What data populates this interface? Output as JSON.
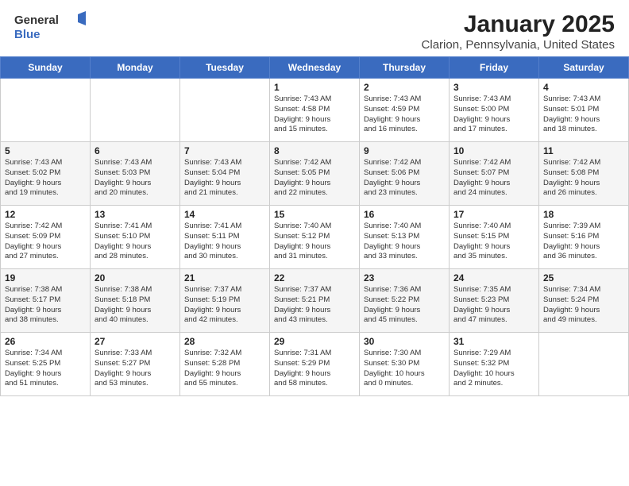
{
  "logo": {
    "text1": "General",
    "text2": "Blue"
  },
  "title": "January 2025",
  "subtitle": "Clarion, Pennsylvania, United States",
  "weekdays": [
    "Sunday",
    "Monday",
    "Tuesday",
    "Wednesday",
    "Thursday",
    "Friday",
    "Saturday"
  ],
  "weeks": [
    [
      {
        "day": "",
        "info": ""
      },
      {
        "day": "",
        "info": ""
      },
      {
        "day": "",
        "info": ""
      },
      {
        "day": "1",
        "info": "Sunrise: 7:43 AM\nSunset: 4:58 PM\nDaylight: 9 hours\nand 15 minutes."
      },
      {
        "day": "2",
        "info": "Sunrise: 7:43 AM\nSunset: 4:59 PM\nDaylight: 9 hours\nand 16 minutes."
      },
      {
        "day": "3",
        "info": "Sunrise: 7:43 AM\nSunset: 5:00 PM\nDaylight: 9 hours\nand 17 minutes."
      },
      {
        "day": "4",
        "info": "Sunrise: 7:43 AM\nSunset: 5:01 PM\nDaylight: 9 hours\nand 18 minutes."
      }
    ],
    [
      {
        "day": "5",
        "info": "Sunrise: 7:43 AM\nSunset: 5:02 PM\nDaylight: 9 hours\nand 19 minutes."
      },
      {
        "day": "6",
        "info": "Sunrise: 7:43 AM\nSunset: 5:03 PM\nDaylight: 9 hours\nand 20 minutes."
      },
      {
        "day": "7",
        "info": "Sunrise: 7:43 AM\nSunset: 5:04 PM\nDaylight: 9 hours\nand 21 minutes."
      },
      {
        "day": "8",
        "info": "Sunrise: 7:42 AM\nSunset: 5:05 PM\nDaylight: 9 hours\nand 22 minutes."
      },
      {
        "day": "9",
        "info": "Sunrise: 7:42 AM\nSunset: 5:06 PM\nDaylight: 9 hours\nand 23 minutes."
      },
      {
        "day": "10",
        "info": "Sunrise: 7:42 AM\nSunset: 5:07 PM\nDaylight: 9 hours\nand 24 minutes."
      },
      {
        "day": "11",
        "info": "Sunrise: 7:42 AM\nSunset: 5:08 PM\nDaylight: 9 hours\nand 26 minutes."
      }
    ],
    [
      {
        "day": "12",
        "info": "Sunrise: 7:42 AM\nSunset: 5:09 PM\nDaylight: 9 hours\nand 27 minutes."
      },
      {
        "day": "13",
        "info": "Sunrise: 7:41 AM\nSunset: 5:10 PM\nDaylight: 9 hours\nand 28 minutes."
      },
      {
        "day": "14",
        "info": "Sunrise: 7:41 AM\nSunset: 5:11 PM\nDaylight: 9 hours\nand 30 minutes."
      },
      {
        "day": "15",
        "info": "Sunrise: 7:40 AM\nSunset: 5:12 PM\nDaylight: 9 hours\nand 31 minutes."
      },
      {
        "day": "16",
        "info": "Sunrise: 7:40 AM\nSunset: 5:13 PM\nDaylight: 9 hours\nand 33 minutes."
      },
      {
        "day": "17",
        "info": "Sunrise: 7:40 AM\nSunset: 5:15 PM\nDaylight: 9 hours\nand 35 minutes."
      },
      {
        "day": "18",
        "info": "Sunrise: 7:39 AM\nSunset: 5:16 PM\nDaylight: 9 hours\nand 36 minutes."
      }
    ],
    [
      {
        "day": "19",
        "info": "Sunrise: 7:38 AM\nSunset: 5:17 PM\nDaylight: 9 hours\nand 38 minutes."
      },
      {
        "day": "20",
        "info": "Sunrise: 7:38 AM\nSunset: 5:18 PM\nDaylight: 9 hours\nand 40 minutes."
      },
      {
        "day": "21",
        "info": "Sunrise: 7:37 AM\nSunset: 5:19 PM\nDaylight: 9 hours\nand 42 minutes."
      },
      {
        "day": "22",
        "info": "Sunrise: 7:37 AM\nSunset: 5:21 PM\nDaylight: 9 hours\nand 43 minutes."
      },
      {
        "day": "23",
        "info": "Sunrise: 7:36 AM\nSunset: 5:22 PM\nDaylight: 9 hours\nand 45 minutes."
      },
      {
        "day": "24",
        "info": "Sunrise: 7:35 AM\nSunset: 5:23 PM\nDaylight: 9 hours\nand 47 minutes."
      },
      {
        "day": "25",
        "info": "Sunrise: 7:34 AM\nSunset: 5:24 PM\nDaylight: 9 hours\nand 49 minutes."
      }
    ],
    [
      {
        "day": "26",
        "info": "Sunrise: 7:34 AM\nSunset: 5:25 PM\nDaylight: 9 hours\nand 51 minutes."
      },
      {
        "day": "27",
        "info": "Sunrise: 7:33 AM\nSunset: 5:27 PM\nDaylight: 9 hours\nand 53 minutes."
      },
      {
        "day": "28",
        "info": "Sunrise: 7:32 AM\nSunset: 5:28 PM\nDaylight: 9 hours\nand 55 minutes."
      },
      {
        "day": "29",
        "info": "Sunrise: 7:31 AM\nSunset: 5:29 PM\nDaylight: 9 hours\nand 58 minutes."
      },
      {
        "day": "30",
        "info": "Sunrise: 7:30 AM\nSunset: 5:30 PM\nDaylight: 10 hours\nand 0 minutes."
      },
      {
        "day": "31",
        "info": "Sunrise: 7:29 AM\nSunset: 5:32 PM\nDaylight: 10 hours\nand 2 minutes."
      },
      {
        "day": "",
        "info": ""
      }
    ]
  ]
}
